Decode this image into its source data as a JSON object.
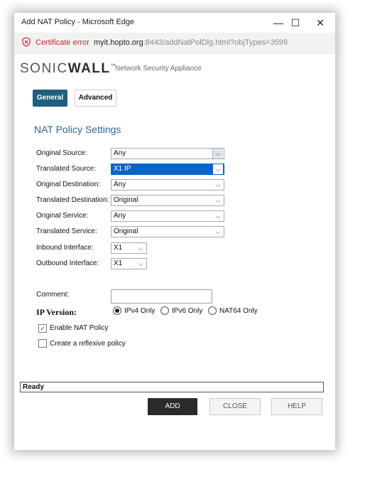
{
  "window": {
    "title": "Add NAT Policy - Microsoft Edge",
    "minimize_glyph": "—",
    "maximize_glyph": "☐",
    "close_glyph": "✕"
  },
  "addressbar": {
    "cert_error": "Certificate error",
    "url_host": "myit.hopto.org",
    "url_rest": ":8443/addNatPolDlg.html?objTypes=3599"
  },
  "brand": {
    "logo_light": "SONIC",
    "logo_bold": "WALL",
    "logo_tm": "™",
    "tagline": "Network Security Appliance"
  },
  "tabs": {
    "general": "General",
    "advanced": "Advanced"
  },
  "section_title": "NAT Policy Settings",
  "fields": {
    "original_source": {
      "label": "Original Source:",
      "value": "Any"
    },
    "translated_source": {
      "label": "Translated Source:",
      "value": "X1 IP"
    },
    "original_destination": {
      "label": "Original Destination:",
      "value": "Any"
    },
    "translated_destination": {
      "label": "Translated Destination:",
      "value": "Original"
    },
    "original_service": {
      "label": "Original Service:",
      "value": "Any"
    },
    "translated_service": {
      "label": "Translated Service:",
      "value": "Original"
    },
    "inbound_interface": {
      "label": "Inbound Interface:",
      "value": "X1"
    },
    "outbound_interface": {
      "label": "Outbound Interface:",
      "value": "X1"
    },
    "comment": {
      "label": "Comment:",
      "value": ""
    }
  },
  "ip_version": {
    "label": "IP Version:",
    "options": [
      "IPv4 Only",
      "IPv6 Only",
      "NAT64 Only"
    ],
    "selected": "IPv4 Only"
  },
  "checkboxes": {
    "enable_nat": {
      "label": "Enable NAT Policy",
      "checked": true,
      "mark": "✓"
    },
    "reflexive": {
      "label": "Create a reflexive policy",
      "checked": false
    }
  },
  "status": "Ready",
  "buttons": {
    "add": "ADD",
    "close": "CLOSE",
    "help": "HELP"
  }
}
